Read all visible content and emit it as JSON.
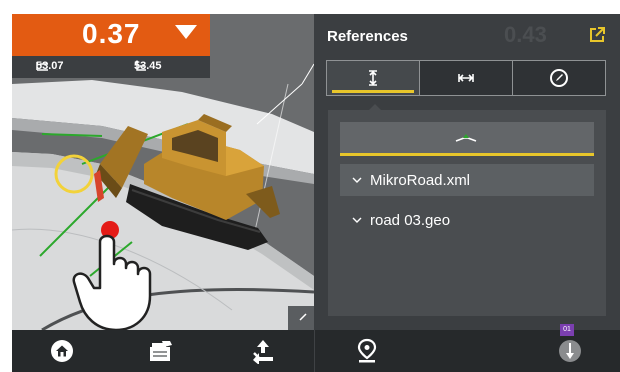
{
  "readout": {
    "primary_value": "0.37",
    "left_sub_value": "53.07",
    "right_sub_value": "53.45",
    "direction_icon": "triangle-down-icon",
    "color": "#e35b12"
  },
  "panel": {
    "title": "References",
    "ghost_value": "0.43",
    "tabs": [
      {
        "icon": "vertical-offset-icon",
        "active": true
      },
      {
        "icon": "horizontal-offset-icon",
        "active": false
      },
      {
        "icon": "compass-icon",
        "active": false
      }
    ],
    "road_button_icon": "road-section-icon",
    "tree_items": [
      {
        "label": "MikroRoad.xml",
        "selected": true
      },
      {
        "label": "road 03.geo",
        "selected": false
      }
    ],
    "accent_color": "#e8c62b"
  },
  "toolbar": {
    "icons": [
      "home-icon",
      "files-icon",
      "arrows-icon",
      "location-icon",
      "plumb-icon"
    ],
    "badge": "01"
  }
}
